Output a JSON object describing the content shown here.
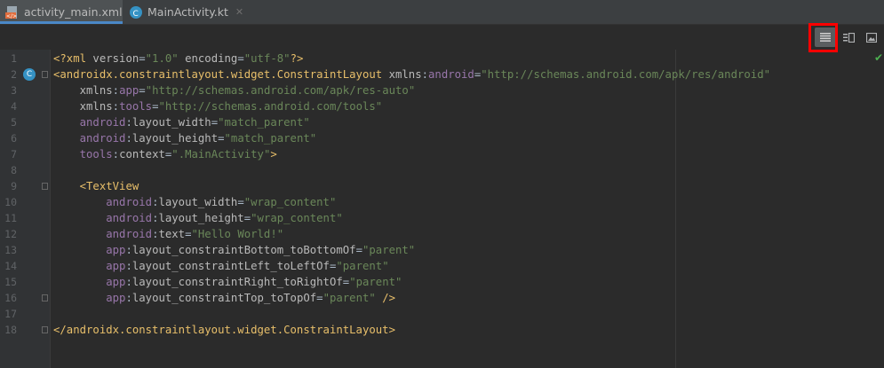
{
  "tabs": [
    {
      "label": "activity_main.xml",
      "icon": "xml-file-icon",
      "active": true
    },
    {
      "label": "MainActivity.kt",
      "icon": "kotlin-class-icon",
      "active": false
    }
  ],
  "colors": {
    "tag": "#e8bf6a",
    "namespace": "#9876aa",
    "attribute": "#bababa",
    "value": "#6a8759",
    "plain": "#a9b7c6",
    "accent": "#4a88c7",
    "highlight_box": "#ff0000"
  },
  "toolbar": {
    "buttons": [
      {
        "icon": "code-view-icon",
        "selected": true
      },
      {
        "icon": "split-view-icon",
        "selected": false
      },
      {
        "icon": "design-view-icon",
        "selected": false
      }
    ]
  },
  "editor": {
    "gutter_badge": "C",
    "status": "check-icon",
    "lines": [
      {
        "n": "1",
        "tokens": [
          [
            "pi",
            "<?xml "
          ],
          [
            "attr",
            "version"
          ],
          [
            "plain",
            "="
          ],
          [
            "val",
            "\"1.0\""
          ],
          [
            "plain",
            " "
          ],
          [
            "attr",
            "encoding"
          ],
          [
            "plain",
            "="
          ],
          [
            "val",
            "\"utf-8\""
          ],
          [
            "pi",
            "?>"
          ]
        ]
      },
      {
        "n": "2",
        "tokens": [
          [
            "tag",
            "<androidx.constraintlayout.widget.ConstraintLayout "
          ],
          [
            "attr",
            "xmlns"
          ],
          [
            "plain",
            ":"
          ],
          [
            "ns",
            "android"
          ],
          [
            "plain",
            "="
          ],
          [
            "val",
            "\"http://schemas.android.com/apk/res/android\""
          ]
        ]
      },
      {
        "n": "3",
        "tokens": [
          [
            "plain",
            "    "
          ],
          [
            "attr",
            "xmlns"
          ],
          [
            "plain",
            ":"
          ],
          [
            "ns",
            "app"
          ],
          [
            "plain",
            "="
          ],
          [
            "val",
            "\"http://schemas.android.com/apk/res-auto\""
          ]
        ]
      },
      {
        "n": "4",
        "tokens": [
          [
            "plain",
            "    "
          ],
          [
            "attr",
            "xmlns"
          ],
          [
            "plain",
            ":"
          ],
          [
            "ns",
            "tools"
          ],
          [
            "plain",
            "="
          ],
          [
            "val",
            "\"http://schemas.android.com/tools\""
          ]
        ]
      },
      {
        "n": "5",
        "tokens": [
          [
            "plain",
            "    "
          ],
          [
            "ns",
            "android"
          ],
          [
            "plain",
            ":"
          ],
          [
            "attr",
            "layout_width"
          ],
          [
            "plain",
            "="
          ],
          [
            "val",
            "\"match_parent\""
          ]
        ]
      },
      {
        "n": "6",
        "tokens": [
          [
            "plain",
            "    "
          ],
          [
            "ns",
            "android"
          ],
          [
            "plain",
            ":"
          ],
          [
            "attr",
            "layout_height"
          ],
          [
            "plain",
            "="
          ],
          [
            "val",
            "\"match_parent\""
          ]
        ]
      },
      {
        "n": "7",
        "tokens": [
          [
            "plain",
            "    "
          ],
          [
            "ns",
            "tools"
          ],
          [
            "plain",
            ":"
          ],
          [
            "attr",
            "context"
          ],
          [
            "plain",
            "="
          ],
          [
            "val",
            "\".MainActivity\""
          ],
          [
            "tag",
            ">"
          ]
        ]
      },
      {
        "n": "8",
        "tokens": []
      },
      {
        "n": "9",
        "tokens": [
          [
            "plain",
            "    "
          ],
          [
            "tag",
            "<TextView"
          ]
        ]
      },
      {
        "n": "10",
        "tokens": [
          [
            "plain",
            "        "
          ],
          [
            "ns",
            "android"
          ],
          [
            "plain",
            ":"
          ],
          [
            "attr",
            "layout_width"
          ],
          [
            "plain",
            "="
          ],
          [
            "val",
            "\"wrap_content\""
          ]
        ]
      },
      {
        "n": "11",
        "tokens": [
          [
            "plain",
            "        "
          ],
          [
            "ns",
            "android"
          ],
          [
            "plain",
            ":"
          ],
          [
            "attr",
            "layout_height"
          ],
          [
            "plain",
            "="
          ],
          [
            "val",
            "\"wrap_content\""
          ]
        ]
      },
      {
        "n": "12",
        "tokens": [
          [
            "plain",
            "        "
          ],
          [
            "ns",
            "android"
          ],
          [
            "plain",
            ":"
          ],
          [
            "attr",
            "text"
          ],
          [
            "plain",
            "="
          ],
          [
            "val",
            "\"Hello World!\""
          ]
        ]
      },
      {
        "n": "13",
        "tokens": [
          [
            "plain",
            "        "
          ],
          [
            "ns",
            "app"
          ],
          [
            "plain",
            ":"
          ],
          [
            "attr",
            "layout_constraintBottom_toBottomOf"
          ],
          [
            "plain",
            "="
          ],
          [
            "val",
            "\"parent\""
          ]
        ]
      },
      {
        "n": "14",
        "tokens": [
          [
            "plain",
            "        "
          ],
          [
            "ns",
            "app"
          ],
          [
            "plain",
            ":"
          ],
          [
            "attr",
            "layout_constraintLeft_toLeftOf"
          ],
          [
            "plain",
            "="
          ],
          [
            "val",
            "\"parent\""
          ]
        ]
      },
      {
        "n": "15",
        "tokens": [
          [
            "plain",
            "        "
          ],
          [
            "ns",
            "app"
          ],
          [
            "plain",
            ":"
          ],
          [
            "attr",
            "layout_constraintRight_toRightOf"
          ],
          [
            "plain",
            "="
          ],
          [
            "val",
            "\"parent\""
          ]
        ]
      },
      {
        "n": "16",
        "tokens": [
          [
            "plain",
            "        "
          ],
          [
            "ns",
            "app"
          ],
          [
            "plain",
            ":"
          ],
          [
            "attr",
            "layout_constraintTop_toTopOf"
          ],
          [
            "plain",
            "="
          ],
          [
            "val",
            "\"parent\""
          ],
          [
            "plain",
            " "
          ],
          [
            "tag",
            "/>"
          ]
        ]
      },
      {
        "n": "17",
        "tokens": []
      },
      {
        "n": "18",
        "tokens": [
          [
            "tag",
            "</androidx.constraintlayout.widget.ConstraintLayout>"
          ]
        ]
      }
    ]
  }
}
